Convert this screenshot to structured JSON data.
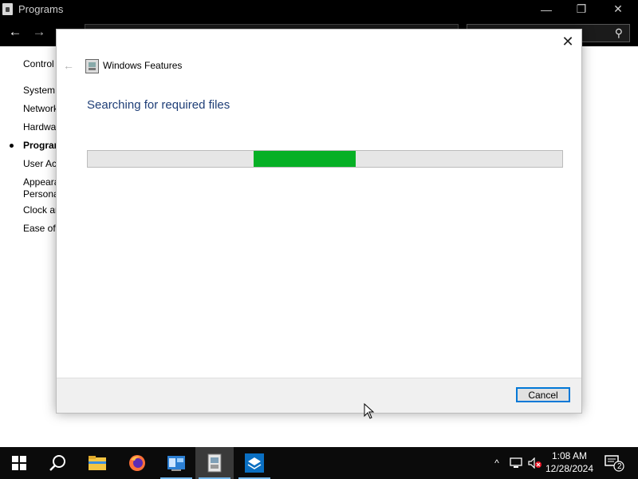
{
  "window": {
    "title": "Programs",
    "minimize_glyph": "—",
    "maximize_glyph": "❐",
    "close_glyph": "✕"
  },
  "nav": {
    "back_glyph": "←",
    "forward_glyph": "→",
    "search_glyph": "⚲"
  },
  "sidebar": {
    "items": [
      {
        "label": "Control"
      },
      {
        "label": "System"
      },
      {
        "label": "Network"
      },
      {
        "label": "Hardware"
      },
      {
        "label": "Programs"
      },
      {
        "label": "User Accounts"
      },
      {
        "label": "Appearance and"
      },
      {
        "label": "Personalization"
      },
      {
        "label": "Clock and"
      },
      {
        "label": "Ease of Access"
      }
    ]
  },
  "dialog": {
    "title": "Windows Features",
    "back_glyph": "←",
    "close_glyph": "✕",
    "heading": "Searching for required files",
    "progress_color": "#06b025",
    "cancel_label": "Cancel"
  },
  "taskbar": {
    "items": [
      {
        "icon": "windows-start-icon"
      },
      {
        "icon": "search-icon"
      },
      {
        "icon": "file-explorer-icon"
      },
      {
        "icon": "firefox-icon"
      },
      {
        "icon": "server-manager-icon"
      },
      {
        "icon": "windows-features-icon"
      },
      {
        "icon": "app-icon"
      }
    ],
    "tray": {
      "chevron_glyph": "^",
      "notification_count": "2"
    },
    "clock": {
      "time": "1:08 AM",
      "date": "12/28/2024"
    }
  }
}
